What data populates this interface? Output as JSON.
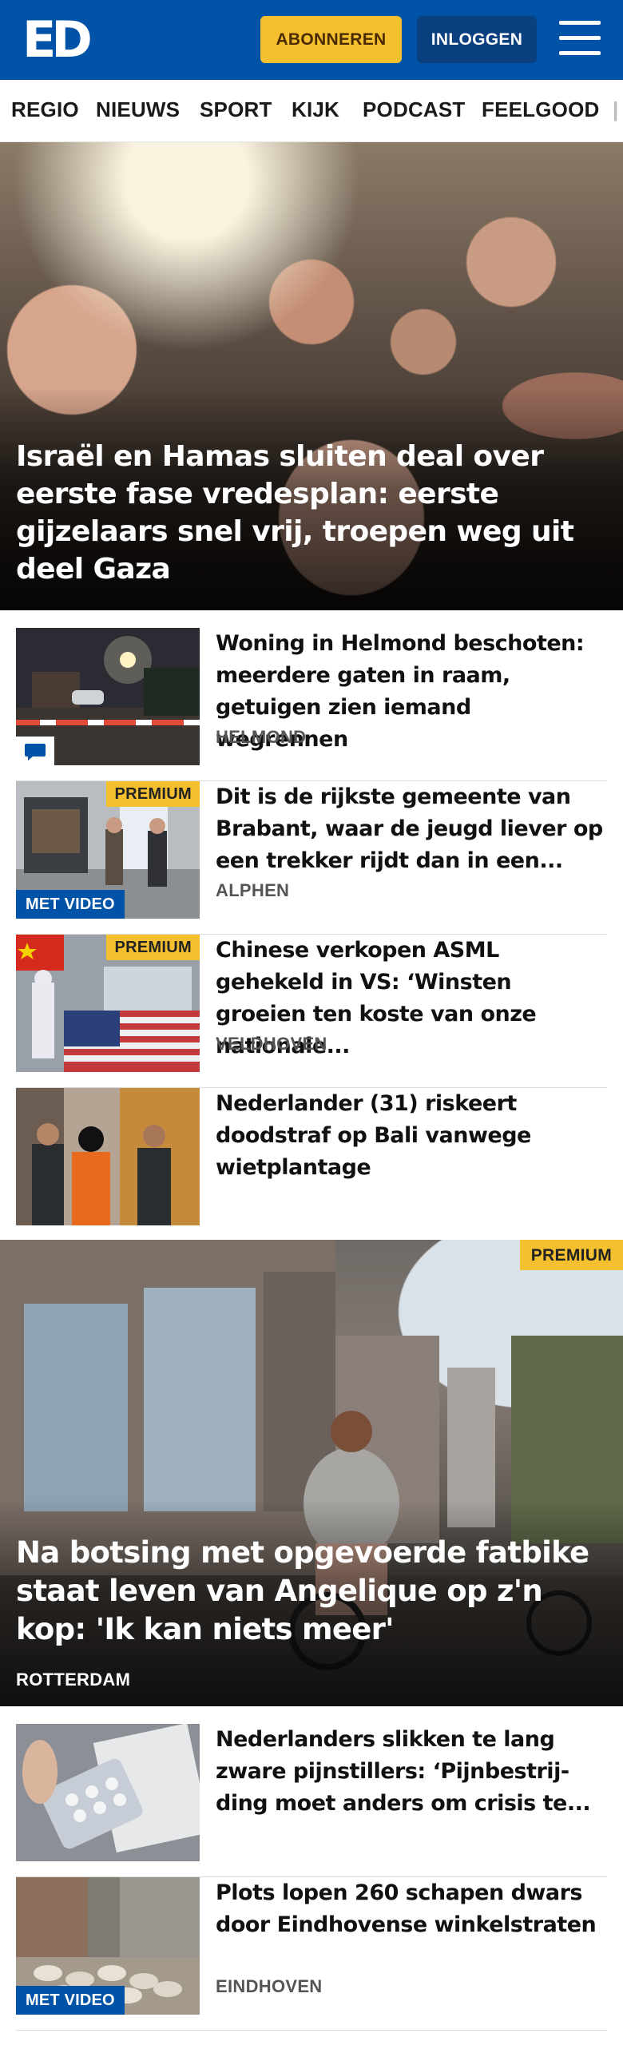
{
  "header": {
    "logo": "ED",
    "subscribe_label": "ABONNEREN",
    "login_label": "INLOGGEN",
    "menu_icon": "hamburger-icon",
    "colors": {
      "brand": "#0053a6",
      "subscribe": "#f5c02f"
    }
  },
  "nav": {
    "items": [
      "REGIO",
      "NIEUWS",
      "SPORT",
      "KIJK",
      "PODCAST",
      "FEELGOOD"
    ]
  },
  "hero": {
    "title": "Israël en Hamas sluiten deal over eerste fase vredesplan: eerste gijzelaars snel vrij, troepen weg uit deel Gaza"
  },
  "articles": [
    {
      "title": "Woning in Helmond beschoten: meerdere gaten in raam, getuigen zien iemand wegrennen",
      "location": "HELMOND",
      "badge": "",
      "video_label": "",
      "comment_icon": "comment-icon"
    },
    {
      "title": "Dit is de rijkste gemeente van Brabant, waar de jeugd liever op een trekker rijdt dan in een...",
      "location": "ALPHEN",
      "badge": "PREMIUM",
      "video_label": "MET VIDEO"
    },
    {
      "title": "Chinese verkopen ASML gehekeld in VS: ‘Winsten groeien ten koste van onze nationale...",
      "location": "VELDHOVEN",
      "badge": "PREMIUM",
      "video_label": ""
    },
    {
      "title": "Nederlander (31) riskeert doodstraf op Bali vanwege wietplantage",
      "location": "",
      "badge": "",
      "video_label": ""
    }
  ],
  "feature": {
    "title": "Na botsing met opgevoerde fatbike staat leven van Angelique op z'n kop: 'Ik kan niets meer'",
    "location": "ROTTERDAM",
    "badge": "PREMIUM"
  },
  "articles2": [
    {
      "title": "Nederlanders slikken te lang zware pijnstillers: ‘Pijnbestrij-ding moet anders om crisis te...",
      "location": "",
      "badge": "",
      "video_label": ""
    },
    {
      "title": "Plots lopen 260 schapen dwars door Eindhovense winkelstraten",
      "location": "EINDHOVEN",
      "badge": "",
      "video_label": "MET VIDEO"
    }
  ]
}
